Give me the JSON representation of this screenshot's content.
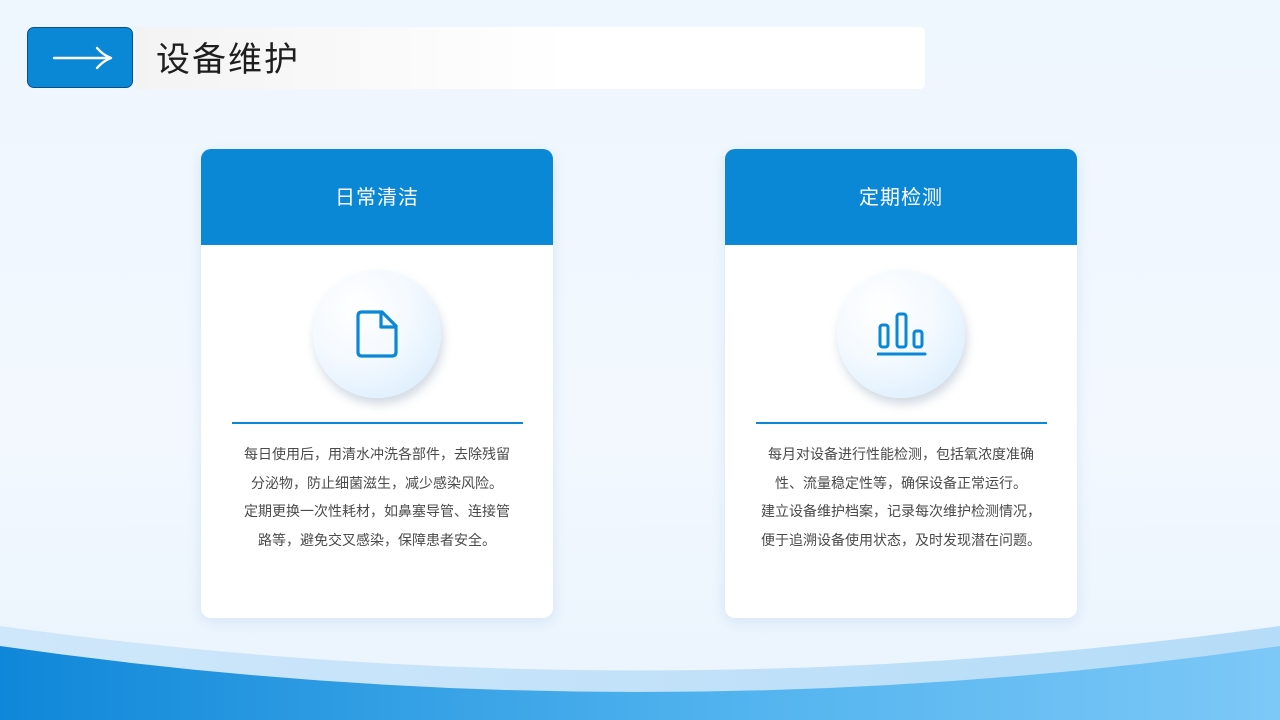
{
  "header": {
    "title": "设备维护",
    "arrow_icon": "arrow-right-icon"
  },
  "cards": [
    {
      "title": "日常清洁",
      "icon": "document-icon",
      "lines": [
        "每日使用后，用清水冲洗各部件，去除残留",
        "分泌物，防止细菌滋生，减少感染风险。",
        "定期更换一次性耗材，如鼻塞导管、连接管",
        "路等，避免交叉感染，保障患者安全。"
      ]
    },
    {
      "title": "定期检测",
      "icon": "bar-chart-icon",
      "lines": [
        "每月对设备进行性能检测，包括氧浓度准确",
        "性、流量稳定性等，确保设备正常运行。",
        "建立设备维护档案，记录每次维护检测情况，",
        "便于追溯设备使用状态，及时发现潜在问题。"
      ]
    }
  ],
  "colors": {
    "accent": "#0a88d6",
    "page_background": "#eef6fe",
    "card_background": "#ffffff",
    "title_text": "#1e1e1e",
    "body_text": "#4a4a4a"
  }
}
